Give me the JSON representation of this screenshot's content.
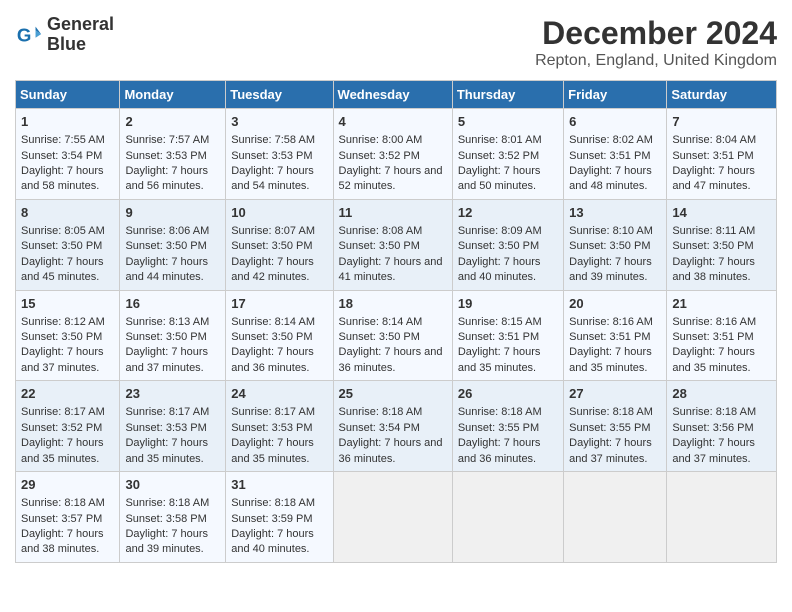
{
  "logo": {
    "line1": "General",
    "line2": "Blue"
  },
  "title": "December 2024",
  "subtitle": "Repton, England, United Kingdom",
  "days_header": [
    "Sunday",
    "Monday",
    "Tuesday",
    "Wednesday",
    "Thursday",
    "Friday",
    "Saturday"
  ],
  "weeks": [
    [
      {
        "day": "1",
        "sunrise": "Sunrise: 7:55 AM",
        "sunset": "Sunset: 3:54 PM",
        "daylight": "Daylight: 7 hours and 58 minutes."
      },
      {
        "day": "2",
        "sunrise": "Sunrise: 7:57 AM",
        "sunset": "Sunset: 3:53 PM",
        "daylight": "Daylight: 7 hours and 56 minutes."
      },
      {
        "day": "3",
        "sunrise": "Sunrise: 7:58 AM",
        "sunset": "Sunset: 3:53 PM",
        "daylight": "Daylight: 7 hours and 54 minutes."
      },
      {
        "day": "4",
        "sunrise": "Sunrise: 8:00 AM",
        "sunset": "Sunset: 3:52 PM",
        "daylight": "Daylight: 7 hours and 52 minutes."
      },
      {
        "day": "5",
        "sunrise": "Sunrise: 8:01 AM",
        "sunset": "Sunset: 3:52 PM",
        "daylight": "Daylight: 7 hours and 50 minutes."
      },
      {
        "day": "6",
        "sunrise": "Sunrise: 8:02 AM",
        "sunset": "Sunset: 3:51 PM",
        "daylight": "Daylight: 7 hours and 48 minutes."
      },
      {
        "day": "7",
        "sunrise": "Sunrise: 8:04 AM",
        "sunset": "Sunset: 3:51 PM",
        "daylight": "Daylight: 7 hours and 47 minutes."
      }
    ],
    [
      {
        "day": "8",
        "sunrise": "Sunrise: 8:05 AM",
        "sunset": "Sunset: 3:50 PM",
        "daylight": "Daylight: 7 hours and 45 minutes."
      },
      {
        "day": "9",
        "sunrise": "Sunrise: 8:06 AM",
        "sunset": "Sunset: 3:50 PM",
        "daylight": "Daylight: 7 hours and 44 minutes."
      },
      {
        "day": "10",
        "sunrise": "Sunrise: 8:07 AM",
        "sunset": "Sunset: 3:50 PM",
        "daylight": "Daylight: 7 hours and 42 minutes."
      },
      {
        "day": "11",
        "sunrise": "Sunrise: 8:08 AM",
        "sunset": "Sunset: 3:50 PM",
        "daylight": "Daylight: 7 hours and 41 minutes."
      },
      {
        "day": "12",
        "sunrise": "Sunrise: 8:09 AM",
        "sunset": "Sunset: 3:50 PM",
        "daylight": "Daylight: 7 hours and 40 minutes."
      },
      {
        "day": "13",
        "sunrise": "Sunrise: 8:10 AM",
        "sunset": "Sunset: 3:50 PM",
        "daylight": "Daylight: 7 hours and 39 minutes."
      },
      {
        "day": "14",
        "sunrise": "Sunrise: 8:11 AM",
        "sunset": "Sunset: 3:50 PM",
        "daylight": "Daylight: 7 hours and 38 minutes."
      }
    ],
    [
      {
        "day": "15",
        "sunrise": "Sunrise: 8:12 AM",
        "sunset": "Sunset: 3:50 PM",
        "daylight": "Daylight: 7 hours and 37 minutes."
      },
      {
        "day": "16",
        "sunrise": "Sunrise: 8:13 AM",
        "sunset": "Sunset: 3:50 PM",
        "daylight": "Daylight: 7 hours and 37 minutes."
      },
      {
        "day": "17",
        "sunrise": "Sunrise: 8:14 AM",
        "sunset": "Sunset: 3:50 PM",
        "daylight": "Daylight: 7 hours and 36 minutes."
      },
      {
        "day": "18",
        "sunrise": "Sunrise: 8:14 AM",
        "sunset": "Sunset: 3:50 PM",
        "daylight": "Daylight: 7 hours and 36 minutes."
      },
      {
        "day": "19",
        "sunrise": "Sunrise: 8:15 AM",
        "sunset": "Sunset: 3:51 PM",
        "daylight": "Daylight: 7 hours and 35 minutes."
      },
      {
        "day": "20",
        "sunrise": "Sunrise: 8:16 AM",
        "sunset": "Sunset: 3:51 PM",
        "daylight": "Daylight: 7 hours and 35 minutes."
      },
      {
        "day": "21",
        "sunrise": "Sunrise: 8:16 AM",
        "sunset": "Sunset: 3:51 PM",
        "daylight": "Daylight: 7 hours and 35 minutes."
      }
    ],
    [
      {
        "day": "22",
        "sunrise": "Sunrise: 8:17 AM",
        "sunset": "Sunset: 3:52 PM",
        "daylight": "Daylight: 7 hours and 35 minutes."
      },
      {
        "day": "23",
        "sunrise": "Sunrise: 8:17 AM",
        "sunset": "Sunset: 3:53 PM",
        "daylight": "Daylight: 7 hours and 35 minutes."
      },
      {
        "day": "24",
        "sunrise": "Sunrise: 8:17 AM",
        "sunset": "Sunset: 3:53 PM",
        "daylight": "Daylight: 7 hours and 35 minutes."
      },
      {
        "day": "25",
        "sunrise": "Sunrise: 8:18 AM",
        "sunset": "Sunset: 3:54 PM",
        "daylight": "Daylight: 7 hours and 36 minutes."
      },
      {
        "day": "26",
        "sunrise": "Sunrise: 8:18 AM",
        "sunset": "Sunset: 3:55 PM",
        "daylight": "Daylight: 7 hours and 36 minutes."
      },
      {
        "day": "27",
        "sunrise": "Sunrise: 8:18 AM",
        "sunset": "Sunset: 3:55 PM",
        "daylight": "Daylight: 7 hours and 37 minutes."
      },
      {
        "day": "28",
        "sunrise": "Sunrise: 8:18 AM",
        "sunset": "Sunset: 3:56 PM",
        "daylight": "Daylight: 7 hours and 37 minutes."
      }
    ],
    [
      {
        "day": "29",
        "sunrise": "Sunrise: 8:18 AM",
        "sunset": "Sunset: 3:57 PM",
        "daylight": "Daylight: 7 hours and 38 minutes."
      },
      {
        "day": "30",
        "sunrise": "Sunrise: 8:18 AM",
        "sunset": "Sunset: 3:58 PM",
        "daylight": "Daylight: 7 hours and 39 minutes."
      },
      {
        "day": "31",
        "sunrise": "Sunrise: 8:18 AM",
        "sunset": "Sunset: 3:59 PM",
        "daylight": "Daylight: 7 hours and 40 minutes."
      },
      null,
      null,
      null,
      null
    ]
  ]
}
